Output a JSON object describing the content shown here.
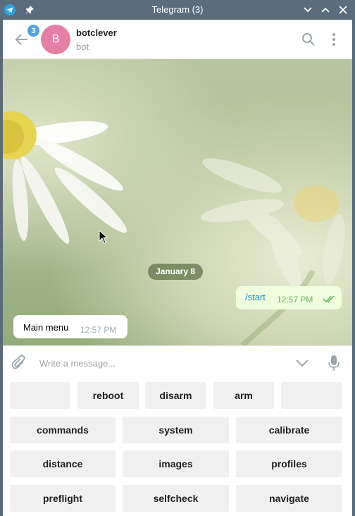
{
  "window": {
    "title": "Telegram (3)",
    "app_icon": "telegram-icon",
    "pin_icon": "pin-icon",
    "controls": [
      "chevron-down-icon",
      "chevron-up-icon",
      "close-icon"
    ]
  },
  "chat_header": {
    "unread_count": "3",
    "avatar_letter": "B",
    "avatar_color": "#e57fa4",
    "name": "botclever",
    "status": "bot"
  },
  "messages": {
    "date_separator": "January 8",
    "outgoing": {
      "text": "/start",
      "time": "12:57 PM",
      "status": "read"
    },
    "incoming": {
      "text": "Main menu",
      "time": "12:57 PM"
    }
  },
  "compose": {
    "placeholder": "Write a message..."
  },
  "bot_keyboard": {
    "row1": [
      "",
      "reboot",
      "disarm",
      "arm",
      ""
    ],
    "row2": [
      "commands",
      "system",
      "calibrate"
    ],
    "row3": [
      "distance",
      "images",
      "profiles"
    ],
    "row4": [
      "preflight",
      "selfcheck",
      "navigate"
    ]
  },
  "colors": {
    "accent": "#4fa3e0",
    "outgoing_bubble": "#effdde",
    "link": "#168acd",
    "titlebar": "#5b6d7d"
  }
}
